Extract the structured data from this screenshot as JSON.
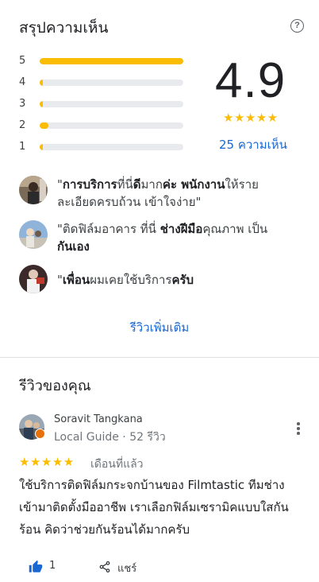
{
  "summary": {
    "title": "สรุปความเห็น",
    "help_icon": "help-circle-icon",
    "rating": "4.9",
    "stars": "★★★★★",
    "review_count": "25 ความเห็น",
    "distribution": [
      {
        "stars": "5",
        "fraction": 1.0
      },
      {
        "stars": "4",
        "fraction": 0.02
      },
      {
        "stars": "3",
        "fraction": 0.02
      },
      {
        "stars": "2",
        "fraction": 0.06
      },
      {
        "stars": "1",
        "fraction": 0.02
      }
    ]
  },
  "snippets": [
    {
      "pre": "\"",
      "b1": "การบริการ",
      "m1": "ที่นี่",
      "b2": "ดี",
      "m2": "มาก",
      "b3": "ค่ะ พนักงาน",
      "post": "ให้รายละเอียดครบถ้วน เข้าใจง่าย\""
    },
    {
      "pre": "\"ติดฟิล์มอาคาร ที่นี่ ",
      "b1": "ช่างฝีมือ",
      "m1": "คุณภาพ เป็น ",
      "b2": "กันเอง",
      "m2": "",
      "b3": "",
      "post": ""
    },
    {
      "pre": "\"",
      "b1": "เพื่อน",
      "m1": "ผมเคยใช้บริการ",
      "b2": "ครับ",
      "m2": "",
      "b3": "",
      "post": ""
    }
  ],
  "more_reviews_label": "รีวิวเพิ่มเติม",
  "your_reviews": {
    "title": "รีวิวของคุณ",
    "review": {
      "author": "Soravit Tangkana",
      "meta": "Local Guide · 52 รีวิว",
      "stars": "★★★★★",
      "date": "เดือนที่แล้ว",
      "body": "ใช้บริการติดฟิล์มกระจกบ้านของ Filmtastic ทีมช่างเข้ามาติดตั้งมืออาชีพ เราเลือกฟิล์มเซรามิคแบบใสกันร้อน คิดว่าช่วยกันร้อนได้มากครับ",
      "like_count": "1",
      "share_label": "แชร์"
    }
  },
  "colors": {
    "star": "#fbbc04",
    "link": "#1967d2",
    "badge": "#e8710a"
  }
}
